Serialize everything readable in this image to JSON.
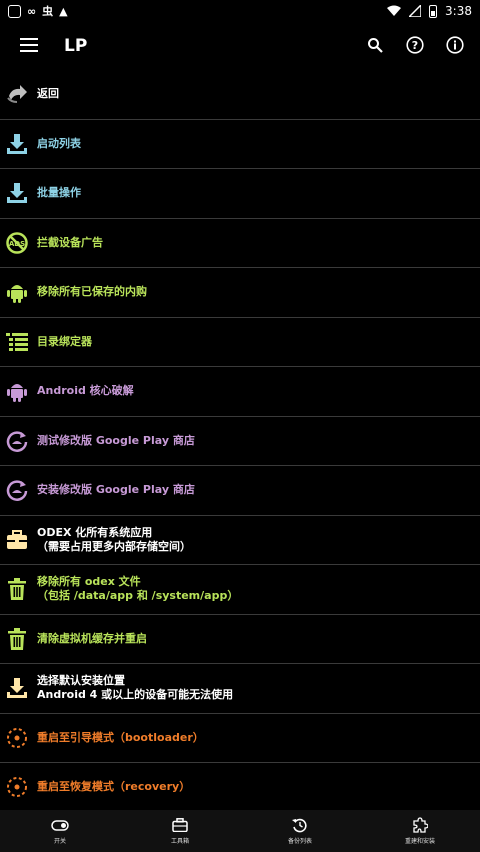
{
  "status": {
    "time": "3:38"
  },
  "appbar": {
    "title": "LP"
  },
  "colors": {
    "blue": "#8ed2e6",
    "green": "#b9e35a",
    "purple": "#c79ad6",
    "white": "#ffffff",
    "orange": "#f07d2a",
    "divider": "#3a3a3a"
  },
  "menu": [
    {
      "label": "返回",
      "icon": "back-arrow-icon"
    },
    {
      "label": "启动列表",
      "icon": "download-tray-icon"
    },
    {
      "label": "批量操作",
      "icon": "download-tray-icon"
    },
    {
      "label": "拦截设备广告",
      "icon": "ads-block-icon"
    },
    {
      "label": "移除所有已保存的内购",
      "icon": "android-icon"
    },
    {
      "label": "目录绑定器",
      "icon": "folder-list-icon"
    },
    {
      "label": "Android 核心破解",
      "icon": "android-icon"
    },
    {
      "label": "测试修改版 Google Play 商店",
      "icon": "refresh-store-icon"
    },
    {
      "label": "安装修改版 Google Play 商店",
      "icon": "refresh-store-icon"
    },
    {
      "label": "ODEX 化所有系统应用",
      "label2": "（需要占用更多内部存储空间）",
      "icon": "toolbox-icon"
    },
    {
      "label": "移除所有 odex 文件",
      "label2": "（包括 /data/app 和 /system/app）",
      "icon": "trash-icon"
    },
    {
      "label": "清除虚拟机缓存并重启",
      "icon": "trash-icon"
    },
    {
      "label": "选择默认安装位置",
      "label2": "Android 4 或以上的设备可能无法使用",
      "icon": "download-tray-icon"
    },
    {
      "label": "重启至引导模式（bootloader）",
      "icon": "reboot-icon"
    },
    {
      "label": "重启至恢复模式（recovery）",
      "icon": "reboot-icon"
    }
  ],
  "bottomnav": [
    {
      "label": "开关",
      "icon": "toggle-icon"
    },
    {
      "label": "工具箱",
      "icon": "toolbox-icon"
    },
    {
      "label": "备份列表",
      "icon": "backup-icon"
    },
    {
      "label": "重建和安装",
      "icon": "puzzle-icon"
    }
  ]
}
